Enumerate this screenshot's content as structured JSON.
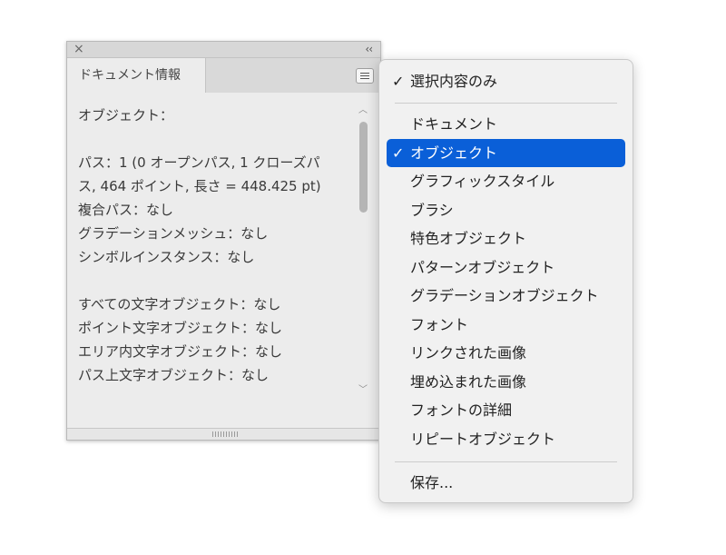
{
  "panel": {
    "close_glyph": "×",
    "collapse_glyph": "‹‹",
    "tab_label": "ドキュメント情報",
    "menu_button_icon": "hamburger-menu-icon",
    "content": {
      "heading": "オブジェクト：",
      "paths_line_1": "パス：1 (0 オープンパス, 1 クローズパ",
      "paths_line_2": "ス, 464 ポイント, 長さ = 448.425 pt)",
      "compound_paths": "複合パス：なし",
      "gradient_meshes": "グラデーションメッシュ：なし",
      "symbol_instances": "シンボルインスタンス：なし",
      "all_text_objects": "すべての文字オブジェクト：なし",
      "point_text_objects": "ポイント文字オブジェクト：なし",
      "area_text_objects": "エリア内文字オブジェクト：なし",
      "path_text_objects": "パス上文字オブジェクト：なし"
    }
  },
  "menu": {
    "check_glyph": "✓",
    "items": [
      {
        "label": "選択内容のみ",
        "checked": true
      },
      {
        "label": "ドキュメント",
        "checked": false
      },
      {
        "label": "オブジェクト",
        "checked": true,
        "highlighted": true
      },
      {
        "label": "グラフィックスタイル",
        "checked": false
      },
      {
        "label": "ブラシ",
        "checked": false
      },
      {
        "label": "特色オブジェクト",
        "checked": false
      },
      {
        "label": "パターンオブジェクト",
        "checked": false
      },
      {
        "label": "グラデーションオブジェクト",
        "checked": false
      },
      {
        "label": "フォント",
        "checked": false
      },
      {
        "label": "リンクされた画像",
        "checked": false
      },
      {
        "label": "埋め込まれた画像",
        "checked": false
      },
      {
        "label": "フォントの詳細",
        "checked": false
      },
      {
        "label": "リピートオブジェクト",
        "checked": false
      },
      {
        "label": "保存...",
        "checked": false
      }
    ]
  },
  "colors": {
    "highlight": "#0a5fd8",
    "panel_bg": "#ececec",
    "menu_bg": "#f1f1f1"
  }
}
